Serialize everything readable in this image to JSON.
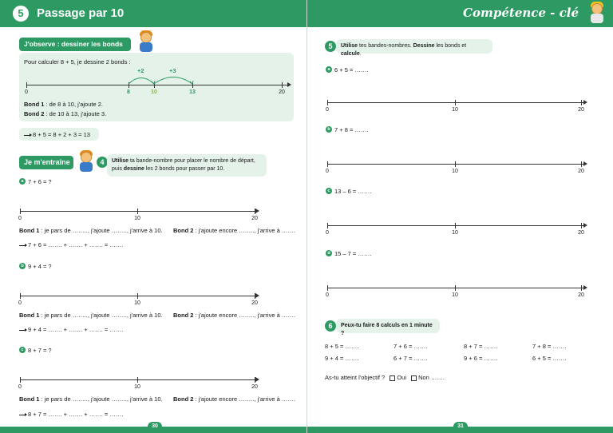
{
  "left": {
    "banner_num": "5",
    "banner_title": "Passage par 10",
    "observe": {
      "label": "J'observe : dessiner les bonds",
      "intro": "Pour calculer 8 + 5, je dessine 2 bonds :",
      "hops": [
        "+2",
        "+3"
      ],
      "ticks": [
        "0",
        "8",
        "10",
        "13",
        "20"
      ],
      "bond1_label": "Bond 1",
      "bond1_text": " : de 8 à 10, j'ajoute 2.",
      "bond2_label": "Bond 2",
      "bond2_text": " : de 10 à 13, j'ajoute 3.",
      "result": "8 + 5 = 8 + 2 + 3 = 13"
    },
    "train_label": "Je m'entraîne",
    "ex4": {
      "num": "4",
      "instr_bold1": "Utilise",
      "instr_1": " ta bande-nombre pour placer le nombre de départ,",
      "instr_2a": "puis ",
      "instr_bold2": "dessine",
      "instr_2b": " les 2 bonds pour passer par 10.",
      "items": [
        {
          "letter": "a",
          "calc": "7 + 6 = ?",
          "result": "7 + 6 = ……. + ……. + ……. = ……."
        },
        {
          "letter": "b",
          "calc": "9 + 4 = ?",
          "result": "9 + 4 = ……. + ……. + ……. = ……."
        },
        {
          "letter": "c",
          "calc": "8 + 7 = ?",
          "result": "8 + 7 = ……. + ……. + ……. = ……."
        }
      ],
      "ticks": [
        "0",
        "10",
        "20"
      ],
      "bond1_label": "Bond 1",
      "bond1_text": " : je pars de …….., j'ajoute …….., j'arrive à 10.",
      "bond2_label": "Bond 2",
      "bond2_text": " : j'ajoute encore …….., j'arrive à ……."
    },
    "page_number": "30"
  },
  "right": {
    "banner_comp": "Compétence - clé",
    "ex5": {
      "num": "5",
      "instr_b1": "Utilise",
      "instr_1": " tes bandes-nombres. ",
      "instr_b2": "Dessine",
      "instr_2": " les bonds et ",
      "instr_b3": "calcule",
      "instr_3": ".",
      "items": [
        {
          "letter": "a",
          "calc": "6 + 5 = ……."
        },
        {
          "letter": "b",
          "calc": "7 + 8 = ……."
        },
        {
          "letter": "c",
          "calc": "13 – 6 = ……."
        },
        {
          "letter": "d",
          "calc": "15 – 7 = ……."
        }
      ],
      "ticks": [
        "0",
        "10",
        "20"
      ]
    },
    "ex6": {
      "num": "6",
      "title": "Peux-tu faire 8 calculs en 1 minute ?",
      "row1": [
        "8 + 5 = …….",
        "7 + 6 = …….",
        "8 + 7 = …….",
        "7 + 8 = ……."
      ],
      "row2": [
        "9 + 4 = …….",
        "6 + 7 = …….",
        "9 + 6 = …….",
        "6 + 5 = ……."
      ],
      "objective": "As-tu atteint l'objectif ?",
      "yes": "Oui",
      "no": "Non ……."
    },
    "page_number": "31"
  }
}
